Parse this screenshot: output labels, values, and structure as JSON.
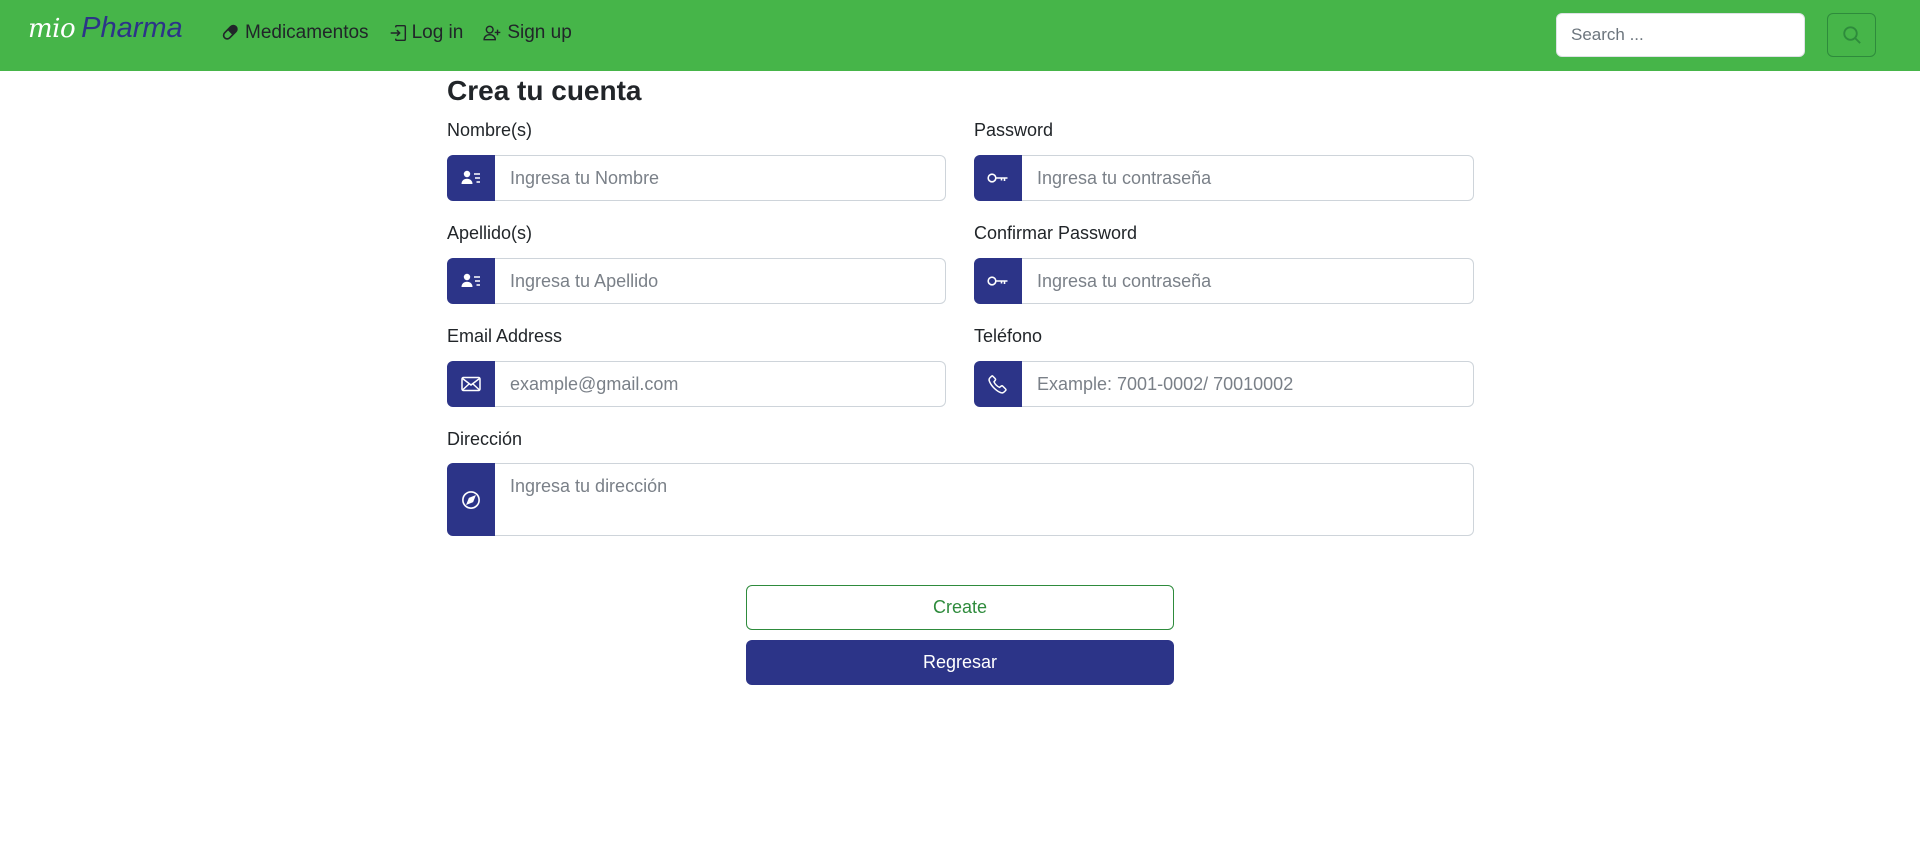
{
  "navbar": {
    "brand_script": "mio",
    "brand_name": "Pharma",
    "links": [
      {
        "label": "Medicamentos",
        "icon": "capsule-icon"
      },
      {
        "label": "Log in",
        "icon": "login-icon"
      },
      {
        "label": "Sign up",
        "icon": "person-add-icon"
      }
    ],
    "search_placeholder": "Search ...",
    "search_icon": "search-icon"
  },
  "form": {
    "title": "Crea tu cuenta",
    "fields": {
      "nombre": {
        "label": "Nombre(s)",
        "placeholder": "Ingresa tu Nombre",
        "icon": "person-lines-icon"
      },
      "password": {
        "label": "Password",
        "placeholder": "Ingresa tu contraseña",
        "icon": "key-icon"
      },
      "apellido": {
        "label": "Apellido(s)",
        "placeholder": "Ingresa tu Apellido",
        "icon": "person-lines-icon"
      },
      "confirm_password": {
        "label": "Confirmar Password",
        "placeholder": "Ingresa tu contraseña",
        "icon": "key-icon"
      },
      "email": {
        "label": "Email Address",
        "placeholder": "example@gmail.com",
        "icon": "envelope-icon"
      },
      "telefono": {
        "label": "Teléfono",
        "placeholder": "Example: 7001-0002/ 70010002",
        "icon": "phone-icon"
      },
      "direccion": {
        "label": "Dirección",
        "placeholder": "Ingresa tu dirección",
        "icon": "compass-icon"
      }
    },
    "create_label": "Create",
    "back_label": "Regresar"
  },
  "colors": {
    "navbar_bg": "#46b549",
    "primary_navy": "#2c3488",
    "success_green": "#2e8b3c"
  }
}
